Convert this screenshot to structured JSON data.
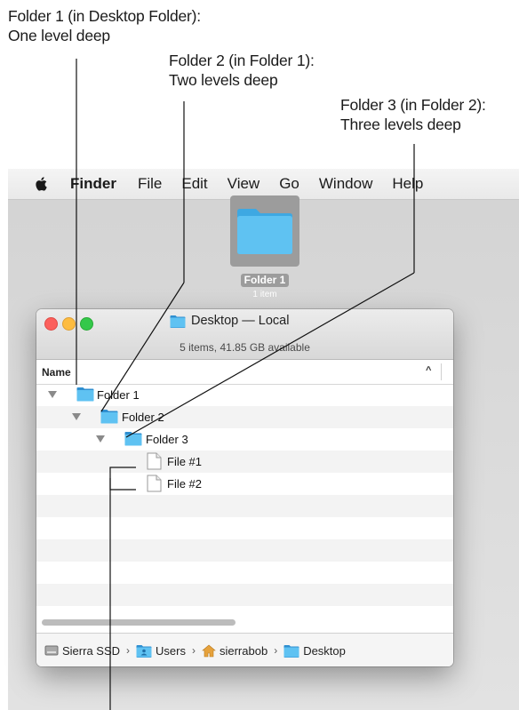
{
  "callouts": [
    {
      "line1": "Folder 1 (in Desktop Folder):",
      "line2": "One level deep"
    },
    {
      "line1": "Folder 2 (in Folder 1):",
      "line2": "Two levels deep"
    },
    {
      "line1": "Folder 3 (in Folder 2):",
      "line2": "Three levels deep"
    }
  ],
  "menubar": {
    "apple_icon": "apple-logo-icon",
    "items": [
      "Finder",
      "File",
      "Edit",
      "View",
      "Go",
      "Window",
      "Help"
    ]
  },
  "desktop_icon": {
    "name": "Folder 1",
    "subtitle": "1 item"
  },
  "window": {
    "title": "Desktop — Local",
    "status": "5 items, 41.85 GB available",
    "column_header": "Name",
    "sort_glyph": "^",
    "rows": [
      {
        "label": "Folder 1",
        "kind": "folder",
        "expanded": true
      },
      {
        "label": "Folder 2",
        "kind": "folder",
        "expanded": true
      },
      {
        "label": "Folder 3",
        "kind": "folder",
        "expanded": true
      },
      {
        "label": "File #1",
        "kind": "file"
      },
      {
        "label": "File #2",
        "kind": "file"
      }
    ],
    "path": [
      {
        "label": "Sierra SSD",
        "icon": "hard-drive-icon"
      },
      {
        "label": "Users",
        "icon": "users-folder-icon"
      },
      {
        "label": "sierrabob",
        "icon": "home-icon"
      },
      {
        "label": "Desktop",
        "icon": "folder-icon"
      }
    ]
  },
  "colors": {
    "folder_blue": "#4fb8ee",
    "traffic_red": "#fc605c",
    "traffic_yellow": "#fdbc40",
    "traffic_green": "#34c84a"
  }
}
